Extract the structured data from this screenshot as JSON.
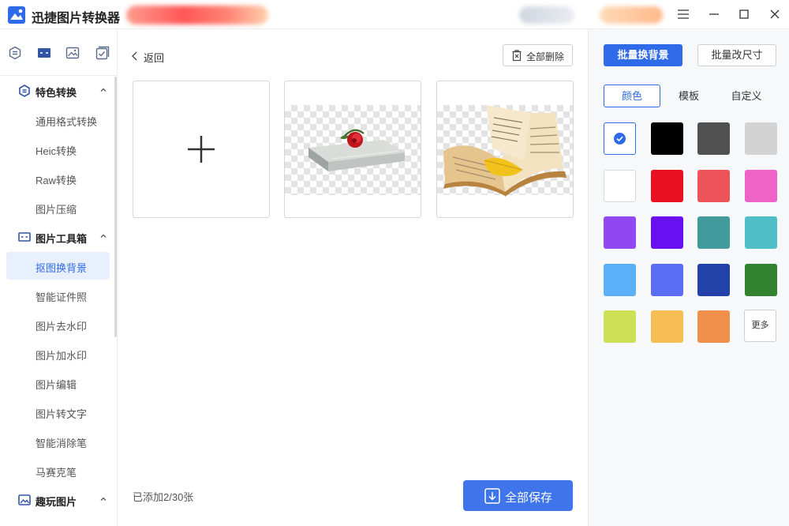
{
  "app": {
    "title": "迅捷图片转换器"
  },
  "sidebar": {
    "groups": [
      {
        "label": "特色转换",
        "items": [
          "通用格式转换",
          "Heic转换",
          "Raw转换",
          "图片压缩"
        ]
      },
      {
        "label": "图片工具箱",
        "items": [
          "抠图换背景",
          "智能证件照",
          "图片去水印",
          "图片加水印",
          "图片编辑",
          "图片转文字",
          "智能消除笔",
          "马赛克笔"
        ]
      },
      {
        "label": "趣玩图片",
        "items": []
      }
    ],
    "active_item": "抠图换背景"
  },
  "main": {
    "back_label": "返回",
    "delete_all_label": "全部删除",
    "added_count": "已添加2/30张",
    "save_all_label": "全部保存"
  },
  "right_panel": {
    "batch_bg_label": "批量换背景",
    "batch_resize_label": "批量改尺寸",
    "tabs": [
      "颜色",
      "模板",
      "自定义"
    ],
    "active_tab": "颜色",
    "colors": [
      "#ffffff",
      "#000000",
      "#505050",
      "#d3d3d3",
      "#ffffff",
      "#e91120",
      "#ec5459",
      "#ee63c6",
      "#9048f2",
      "#6a10f0",
      "#419a9b",
      "#4ebfc6",
      "#5cb0f8",
      "#5b6cf5",
      "#2242aa",
      "#33822f",
      "#cce156",
      "#f5bd54",
      "#ef8f4a"
    ],
    "selected_color_index": 0,
    "more_label": "更多"
  },
  "accent_color": "#2f6be8"
}
